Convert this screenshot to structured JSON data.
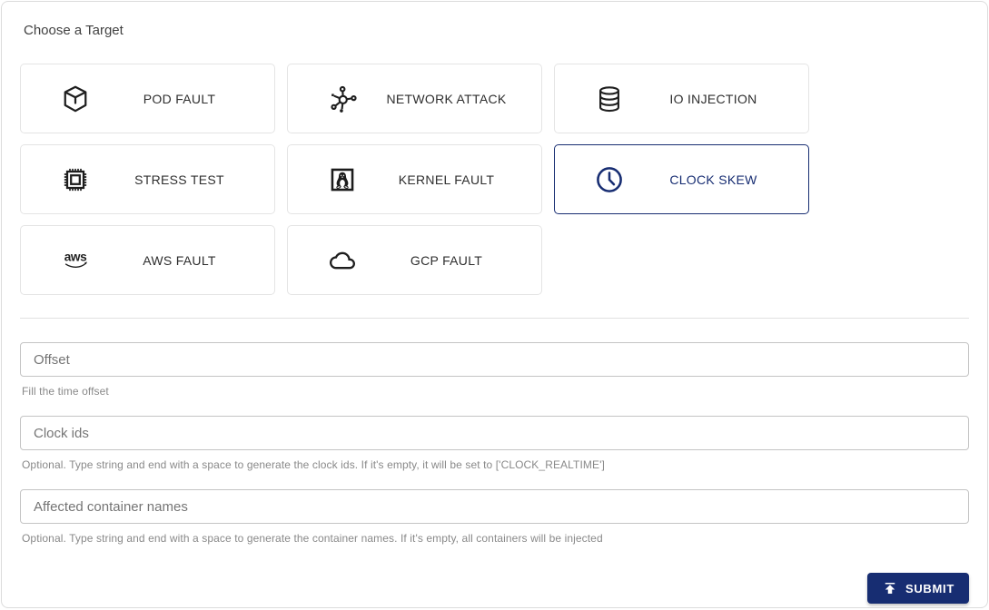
{
  "page": {
    "title": "Choose a Target"
  },
  "targets": {
    "items": [
      {
        "label": "POD FAULT",
        "icon": "cube-icon",
        "selected": false
      },
      {
        "label": "NETWORK ATTACK",
        "icon": "network-hub-icon",
        "selected": false
      },
      {
        "label": "IO INJECTION",
        "icon": "database-icon",
        "selected": false
      },
      {
        "label": "STRESS TEST",
        "icon": "cpu-chip-icon",
        "selected": false
      },
      {
        "label": "KERNEL FAULT",
        "icon": "linux-penguin-icon",
        "selected": false
      },
      {
        "label": "CLOCK SKEW",
        "icon": "clock-icon",
        "selected": true
      },
      {
        "label": "AWS FAULT",
        "icon": "aws-logo-icon",
        "selected": false
      },
      {
        "label": "GCP FAULT",
        "icon": "cloud-icon",
        "selected": false
      }
    ]
  },
  "form": {
    "fields": [
      {
        "placeholder": "Offset",
        "helper": "Fill the time offset"
      },
      {
        "placeholder": "Clock ids",
        "helper": "Optional. Type string and end with a space to generate the clock ids. If it's empty, it will be set to ['CLOCK_REALTIME']"
      },
      {
        "placeholder": "Affected container names",
        "helper": "Optional. Type string and end with a space to generate the container names. If it's empty, all containers will be injected"
      }
    ],
    "submit_label": "SUBMIT"
  },
  "colors": {
    "primary": "#172d72",
    "card_border": "#e4e4e4",
    "input_border": "#c4c4c4",
    "helper_text": "#898989"
  }
}
